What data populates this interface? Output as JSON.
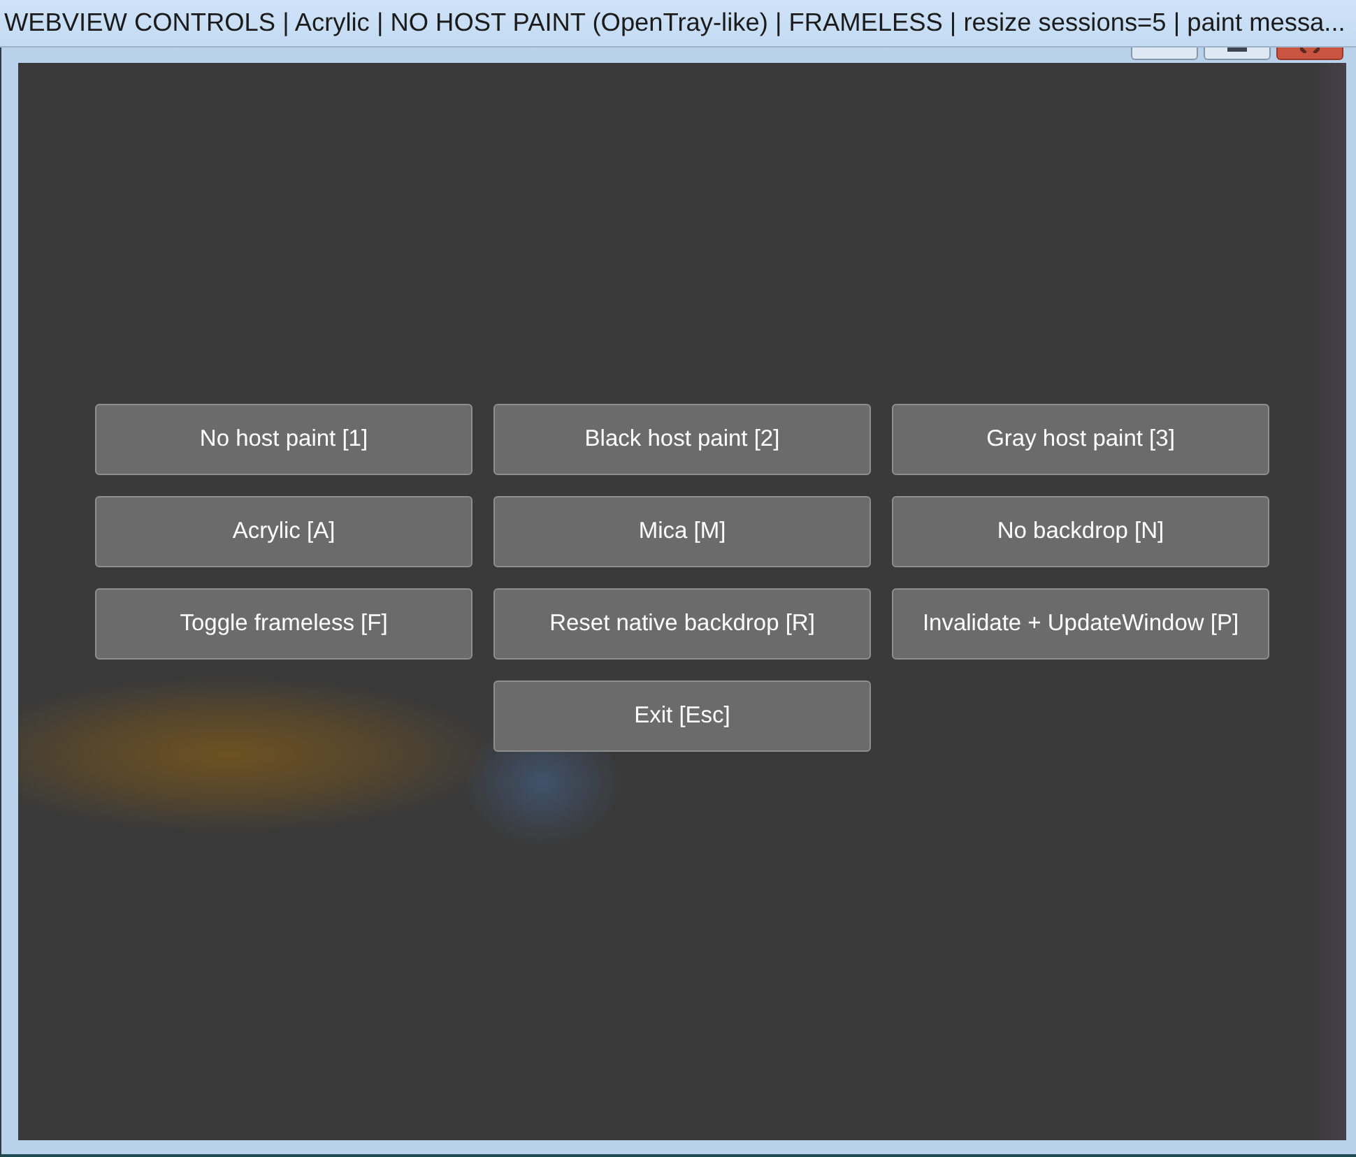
{
  "title_bar": {
    "title": "WEBVIEW CONTROLS | Acrylic | NO HOST PAINT (OpenTray-like) | FRAMELESS | resize sessions=5 | paint messa..."
  },
  "caption_buttons": [
    {
      "kind": "minimize"
    },
    {
      "kind": "maximize"
    },
    {
      "kind": "close"
    }
  ],
  "buttons": [
    {
      "label": "No host paint [1]"
    },
    {
      "label": "Black host paint [2]"
    },
    {
      "label": "Gray host paint [3]"
    },
    {
      "label": "Acrylic [A]"
    },
    {
      "label": "Mica [M]"
    },
    {
      "label": "No backdrop [N]"
    },
    {
      "label": "Toggle frameless [F]"
    },
    {
      "label": "Reset native backdrop [R]"
    },
    {
      "label": "Invalidate + UpdateWindow [P]"
    },
    {
      "label": "Exit [Esc]"
    }
  ]
}
